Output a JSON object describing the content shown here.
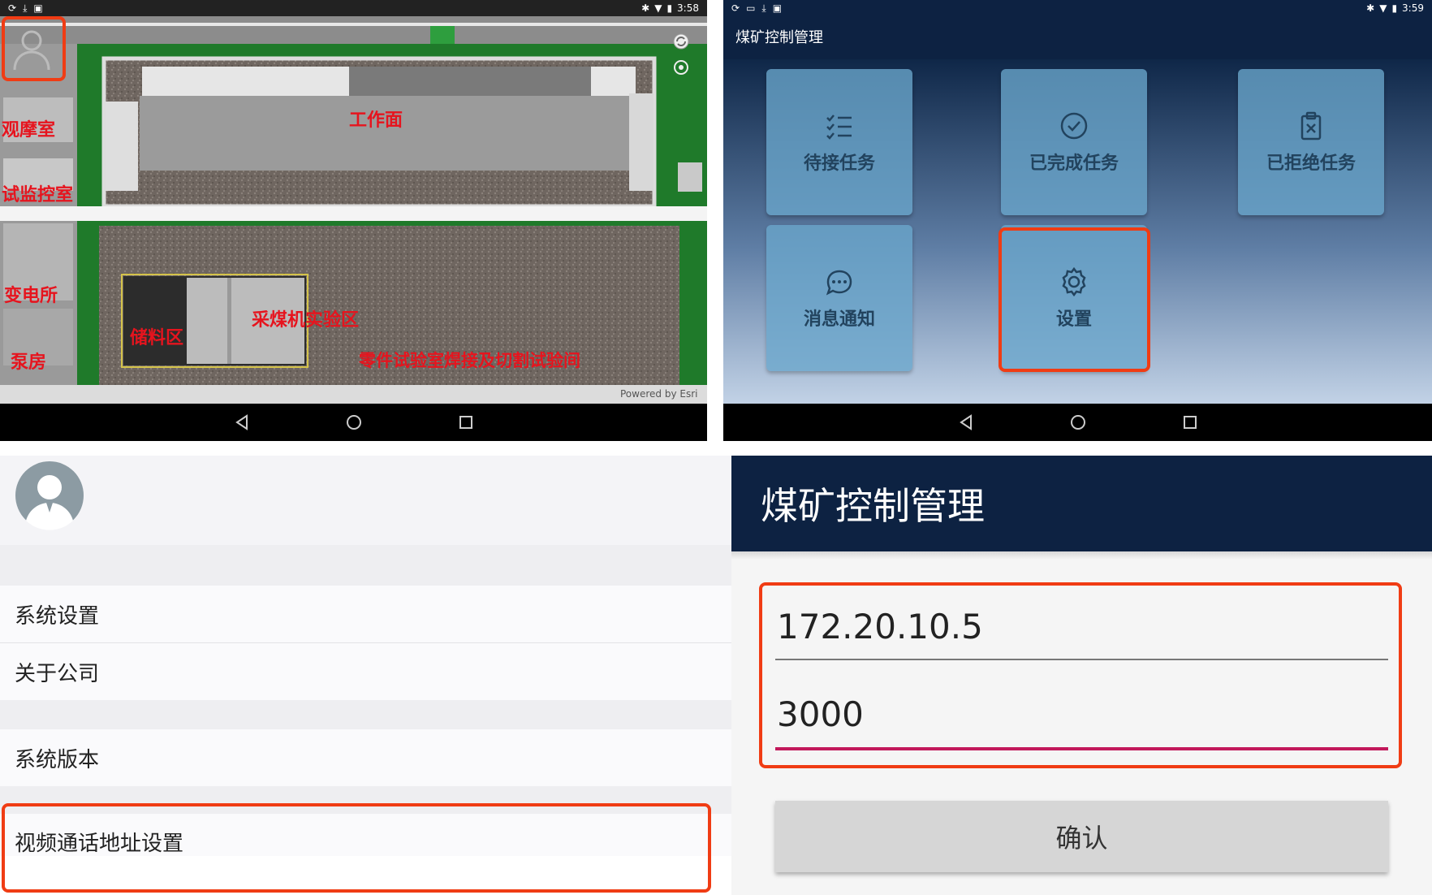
{
  "panel1": {
    "time": "3:58",
    "labels": {
      "observation_room": "观摩室",
      "test_control_room": "试监控室",
      "substation": "变电所",
      "pump_room": "泵房",
      "work_face": "工作面",
      "storage_area": "储料区",
      "shearer_test_area": "采煤机实验区",
      "parts_test_room": "零件试验室焊接及切割试验间"
    },
    "attribution": "Powered by Esri"
  },
  "panel2": {
    "time": "3:59",
    "app_title": "煤矿控制管理",
    "tiles": {
      "pending_tasks": "待接任务",
      "completed_tasks": "已完成任务",
      "rejected_tasks": "已拒绝任务",
      "notifications": "消息通知",
      "settings": "设置"
    }
  },
  "panel3": {
    "items": {
      "system_settings": "系统设置",
      "about_company": "关于公司",
      "system_version": "系统版本",
      "video_call_address": "视频通话地址设置"
    }
  },
  "panel4": {
    "title": "煤矿控制管理",
    "ip_value": "172.20.10.5",
    "port_value": "3000",
    "confirm_label": "确认"
  },
  "colors": {
    "highlight": "#f03c14",
    "header_navy": "#0d2242",
    "map_label_red": "#e6141e",
    "tile_blue": "#6aa6cc",
    "input_active_underline": "#c2185b"
  },
  "icons": [
    "user-icon",
    "refresh-icon",
    "locate-icon",
    "back-icon",
    "home-icon",
    "recents-icon",
    "list-check-icon",
    "check-circle-icon",
    "clipboard-x-icon",
    "chat-bubble-icon",
    "gear-icon",
    "avatar-icon",
    "bluetooth-icon",
    "wifi-icon",
    "battery-icon",
    "download-icon",
    "lock-icon",
    "sync-icon"
  ]
}
